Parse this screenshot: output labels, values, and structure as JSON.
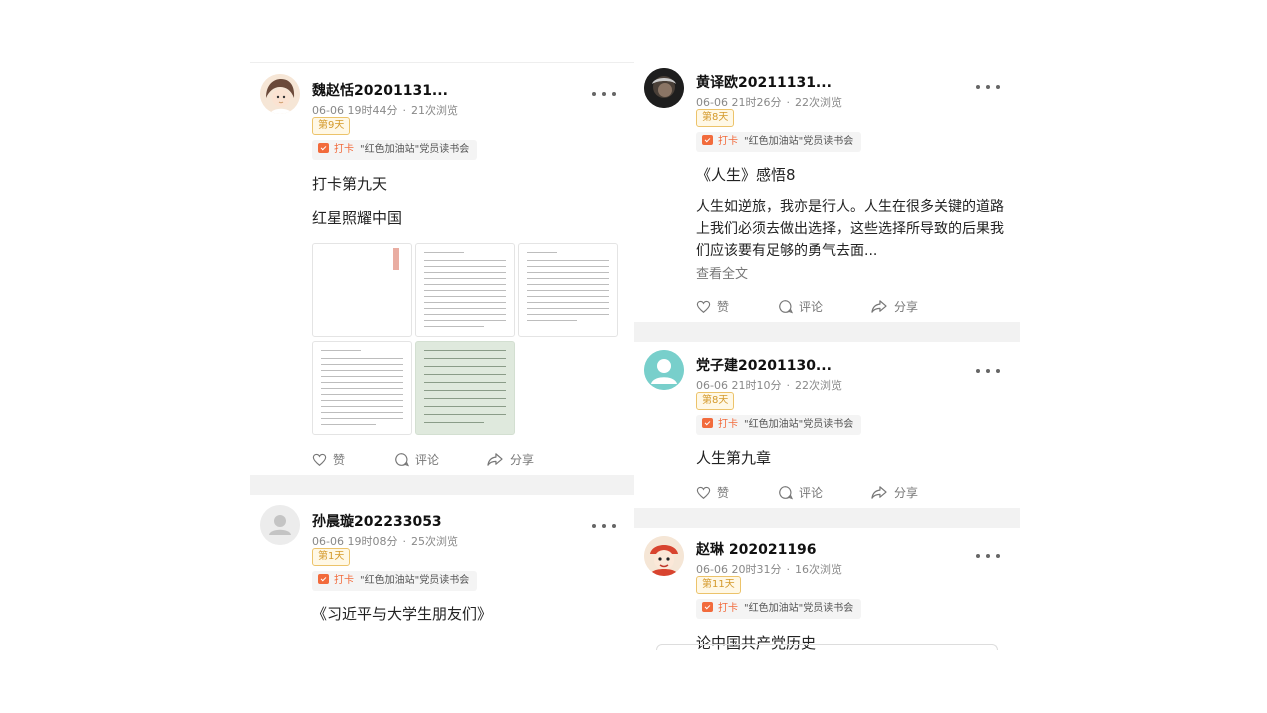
{
  "left_posts": [
    {
      "username": "魏赵恬20201131...",
      "time": "06-06 19时44分",
      "views": "21次浏览",
      "badge": "第9天",
      "tag_checkin": "打卡",
      "tag_group": "\"红色加油站\"党员读书会",
      "lines": [
        "打卡第九天",
        "红星照耀中国"
      ],
      "actions": {
        "like": "赞",
        "comment": "评论",
        "share": "分享"
      }
    },
    {
      "username": "孙晨璇202233053",
      "time": "06-06 19时08分",
      "views": "25次浏览",
      "badge": "第1天",
      "tag_checkin": "打卡",
      "tag_group": "\"红色加油站\"党员读书会",
      "lines": [
        "《习近平与大学生朋友们》"
      ]
    }
  ],
  "right_posts": [
    {
      "username": "黄译欧20211131...",
      "time": "06-06 21时26分",
      "views": "22次浏览",
      "badge": "第8天",
      "tag_checkin": "打卡",
      "tag_group": "\"红色加油站\"党员读书会",
      "title": "《人生》感悟8",
      "body": "人生如逆旅，我亦是行人。人生在很多关键的道路上我们必须去做出选择，这些选择所导致的后果我们应该要有足够的勇气去面...",
      "read_all": "查看全文",
      "actions": {
        "like": "赞",
        "comment": "评论",
        "share": "分享"
      }
    },
    {
      "username": "党子建20201130...",
      "time": "06-06 21时10分",
      "views": "22次浏览",
      "badge": "第8天",
      "tag_checkin": "打卡",
      "tag_group": "\"红色加油站\"党员读书会",
      "lines": [
        "人生第九章"
      ],
      "actions": {
        "like": "赞",
        "comment": "评论",
        "share": "分享"
      }
    },
    {
      "username": "赵琳 202021196",
      "time": "06-06 20时31分",
      "views": "16次浏览",
      "badge": "第11天",
      "tag_checkin": "打卡",
      "tag_group": "\"红色加油站\"党员读书会",
      "lines": [
        "论中国共产党历史"
      ]
    }
  ],
  "icons": {
    "more": "more-dots-icon",
    "like": "heart-icon",
    "comment": "comment-bubble-icon",
    "share": "share-arrow-icon",
    "tag": "checkin-icon"
  },
  "colors": {
    "badge": "#d4992a",
    "checkin": "#f26b3c",
    "separator": "#f2f2f2"
  }
}
